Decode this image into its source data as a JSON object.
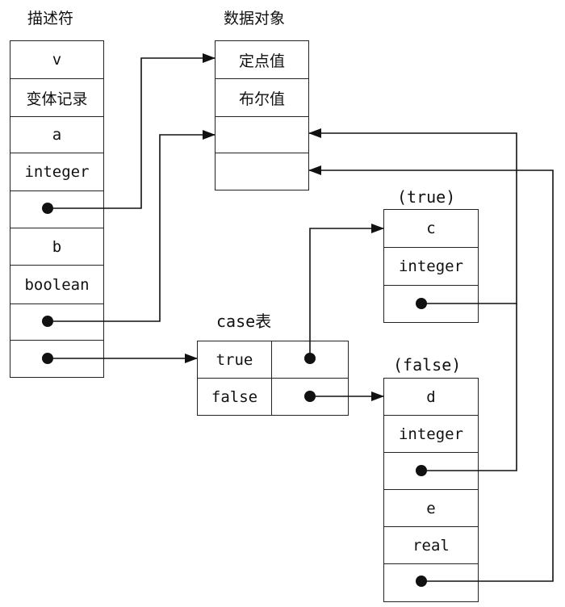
{
  "descriptor": {
    "title": "描述符",
    "cells": [
      "v",
      "变体记录",
      "a",
      "integer",
      "",
      "b",
      "boolean",
      "",
      ""
    ]
  },
  "data_object": {
    "title": "数据对象",
    "cells": [
      "定点值",
      "布尔值",
      "",
      ""
    ]
  },
  "case_table": {
    "title": "case表",
    "rows": [
      {
        "key": "true"
      },
      {
        "key": "false"
      }
    ]
  },
  "true_variant": {
    "title": "(true)",
    "cells": [
      "c",
      "integer",
      ""
    ]
  },
  "false_variant": {
    "title": "(false)",
    "cells": [
      "d",
      "integer",
      "",
      "e",
      "real",
      ""
    ]
  }
}
